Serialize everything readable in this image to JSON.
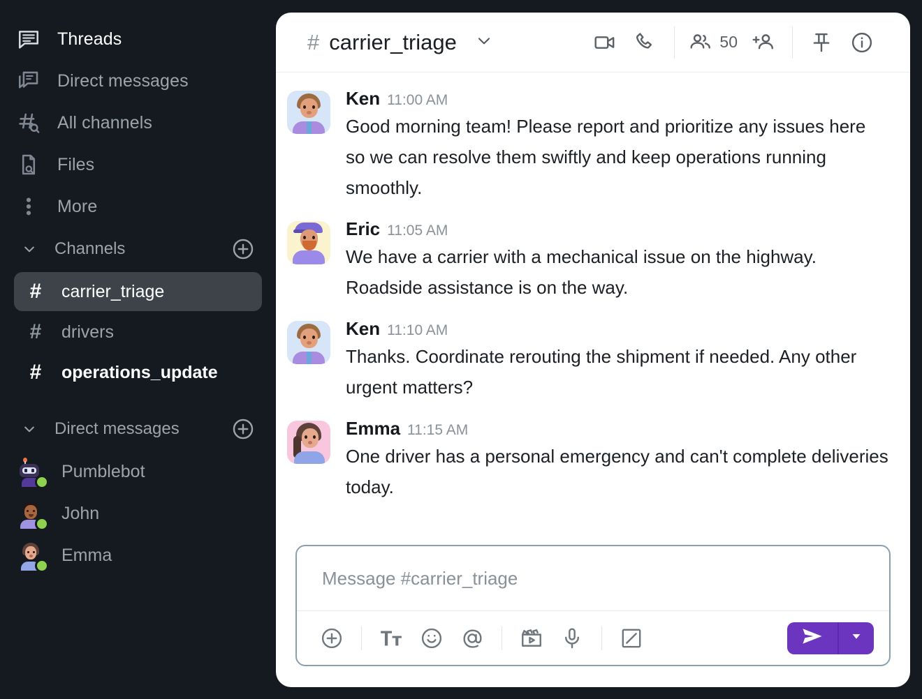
{
  "app": {
    "background": "#141a1f",
    "accent": "#6b35c0"
  },
  "sidebar": {
    "nav": [
      {
        "label": "Threads",
        "icon": "threads-icon",
        "active": true
      },
      {
        "label": "Direct messages",
        "icon": "direct-messages-icon",
        "active": false
      },
      {
        "label": "All channels",
        "icon": "all-channels-icon",
        "active": false
      },
      {
        "label": "Files",
        "icon": "files-icon",
        "active": false
      },
      {
        "label": "More",
        "icon": "more-icon",
        "active": false
      }
    ],
    "channels_section": {
      "title": "Channels",
      "add_icon": "plus-circle-icon",
      "collapse_icon": "chevron-down-icon",
      "items": [
        {
          "name": "carrier_triage",
          "hash": "#",
          "state": "selected"
        },
        {
          "name": "drivers",
          "hash": "#",
          "state": "read"
        },
        {
          "name": "operations_update",
          "hash": "#",
          "state": "unread"
        }
      ]
    },
    "dm_section": {
      "title": "Direct messages",
      "add_icon": "plus-circle-icon",
      "collapse_icon": "chevron-down-icon",
      "items": [
        {
          "name": "Pumblebot",
          "presence": "online",
          "avatar": "bot"
        },
        {
          "name": "John",
          "presence": "online",
          "avatar": "john"
        },
        {
          "name": "Emma",
          "presence": "online",
          "avatar": "emma"
        }
      ]
    }
  },
  "header": {
    "hash": "#",
    "channel": "carrier_triage",
    "dropdown_icon": "chevron-down-icon",
    "actions": [
      {
        "name": "video-call-icon",
        "label": "Start video call"
      },
      {
        "name": "phone-call-icon",
        "label": "Start call"
      }
    ],
    "members_icon": "members-icon",
    "member_count": "50",
    "add_member_icon": "add-member-icon",
    "pin_icon": "pin-icon",
    "info_icon": "info-icon"
  },
  "messages": [
    {
      "author": "Ken",
      "time": "11:00 AM",
      "avatar": "ken",
      "text": "Good morning team! Please report and prioritize any issues here so we can resolve them swiftly and keep operations running smoothly."
    },
    {
      "author": "Eric",
      "time": "11:05 AM",
      "avatar": "eric",
      "text": "We have a carrier with a mechanical issue on the highway. Roadside assistance is on the way."
    },
    {
      "author": "Ken",
      "time": "11:10 AM",
      "avatar": "ken",
      "text": "Thanks. Coordinate rerouting the shipment if needed. Any other urgent matters?"
    },
    {
      "author": "Emma",
      "time": "11:15 AM",
      "avatar": "emma",
      "text": "One driver has a personal emergency and can't complete deliveries today."
    }
  ],
  "composer": {
    "placeholder": "Message #carrier_triage",
    "value": "",
    "tools": [
      {
        "name": "attach-plus-icon",
        "label": "Attach"
      },
      {
        "name": "format-text-icon",
        "label": "Format text"
      },
      {
        "name": "emoji-icon",
        "label": "Emoji"
      },
      {
        "name": "mention-icon",
        "label": "Mention"
      },
      {
        "name": "video-clip-icon",
        "label": "Video clip"
      },
      {
        "name": "microphone-icon",
        "label": "Voice clip"
      },
      {
        "name": "draw-icon",
        "label": "Draw"
      }
    ],
    "send_icon": "send-icon",
    "send_options_icon": "caret-down-icon"
  }
}
